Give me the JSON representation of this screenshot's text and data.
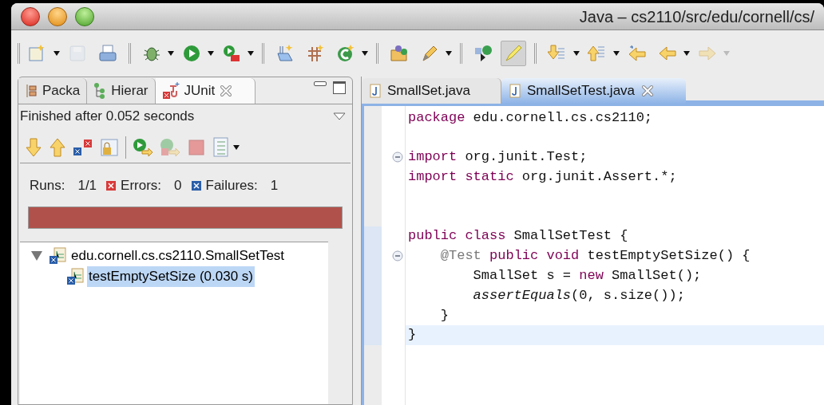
{
  "window": {
    "title": "Java – cs2110/src/edu/cornell/cs/"
  },
  "toolbar": [
    {
      "kind": "new",
      "dropdown": true,
      "disabled": false,
      "selected": false
    },
    {
      "kind": "save",
      "dropdown": false,
      "disabled": true,
      "selected": false
    },
    {
      "kind": "print",
      "dropdown": false,
      "disabled": false,
      "selected": false
    },
    {
      "kind": "sep"
    },
    {
      "kind": "debug",
      "dropdown": true,
      "disabled": false,
      "selected": false
    },
    {
      "kind": "run",
      "dropdown": true,
      "disabled": false,
      "selected": false
    },
    {
      "kind": "external",
      "dropdown": true,
      "disabled": false,
      "selected": false
    },
    {
      "kind": "sep"
    },
    {
      "kind": "package",
      "dropdown": false,
      "disabled": false,
      "selected": false
    },
    {
      "kind": "grid",
      "dropdown": false,
      "disabled": false,
      "selected": false
    },
    {
      "kind": "class",
      "dropdown": true,
      "disabled": false,
      "selected": false
    },
    {
      "kind": "sep"
    },
    {
      "kind": "folder",
      "dropdown": false,
      "disabled": false,
      "selected": false
    },
    {
      "kind": "pen",
      "dropdown": true,
      "disabled": false,
      "selected": false
    },
    {
      "kind": "sep"
    },
    {
      "kind": "hierarchy",
      "dropdown": false,
      "disabled": false,
      "selected": false
    },
    {
      "kind": "highlight",
      "dropdown": false,
      "disabled": false,
      "selected": true
    },
    {
      "kind": "sep"
    },
    {
      "kind": "next",
      "dropdown": true,
      "disabled": false,
      "selected": false
    },
    {
      "kind": "prev",
      "dropdown": true,
      "disabled": false,
      "selected": false
    },
    {
      "kind": "last_edit",
      "dropdown": false,
      "disabled": false,
      "selected": false
    },
    {
      "kind": "back",
      "dropdown": true,
      "disabled": false,
      "selected": false
    },
    {
      "kind": "forward",
      "dropdown": true,
      "disabled": true,
      "selected": false
    }
  ],
  "view_tabs": [
    {
      "kind": "package",
      "label": "Packa",
      "selected": false,
      "closable": false
    },
    {
      "kind": "hierarchy",
      "label": "Hierar",
      "selected": false,
      "closable": false
    },
    {
      "kind": "junit",
      "label": "JUnit",
      "selected": true,
      "closable": true
    }
  ],
  "junit": {
    "status": "Finished after 0.052 seconds",
    "counters": [
      {
        "kind": "runs",
        "label": "Runs:",
        "value": "1/1"
      },
      {
        "kind": "errors",
        "label": "Errors:",
        "value": "0"
      },
      {
        "kind": "failures",
        "label": "Failures:",
        "value": "1"
      }
    ],
    "progress": {
      "level": 1,
      "color": "#b0524b"
    },
    "tree": [
      {
        "label": "edu.cornell.cs.cs2110.SmallSetTest",
        "expanded": true,
        "selected": false,
        "children": [
          {
            "label": "testEmptySetSize (0.030 s)",
            "selected": true
          }
        ]
      }
    ]
  },
  "editor_tabs": [
    {
      "label": "SmallSet.java",
      "selected": false,
      "closable": false
    },
    {
      "label": "SmallSetTest.java",
      "selected": true,
      "closable": true
    }
  ],
  "code": [
    {
      "fold": false,
      "current": false,
      "tokens": [
        {
          "kind": "keyword",
          "text": "package"
        },
        {
          "kind": "plain",
          "text": " edu.cornell.cs.cs2110;"
        }
      ]
    },
    {
      "fold": false,
      "current": false
    },
    {
      "fold": true,
      "current": false,
      "tokens": [
        {
          "kind": "keyword",
          "text": "import"
        },
        {
          "kind": "plain",
          "text": " org.junit.Test;"
        }
      ]
    },
    {
      "fold": false,
      "current": false,
      "tokens": [
        {
          "kind": "keyword",
          "text": "import static"
        },
        {
          "kind": "plain",
          "text": " org.junit.Assert.*;"
        }
      ]
    },
    {
      "fold": false,
      "current": false
    },
    {
      "fold": false,
      "current": false
    },
    {
      "fold": false,
      "current": false,
      "tokens": [
        {
          "kind": "keyword",
          "text": "public class"
        },
        {
          "kind": "plain",
          "text": " SmallSetTest {"
        }
      ]
    },
    {
      "fold": true,
      "current": false,
      "tokens": [
        {
          "kind": "annotation",
          "text": "    @Test"
        },
        {
          "kind": "keyword",
          "text": " public void"
        },
        {
          "kind": "plain",
          "text": " testEmptySetSize() {"
        }
      ]
    },
    {
      "fold": false,
      "current": false,
      "tokens": [
        {
          "kind": "plain",
          "text": "        SmallSet s = "
        },
        {
          "kind": "keyword",
          "text": "new"
        },
        {
          "kind": "plain",
          "text": " SmallSet();"
        }
      ]
    },
    {
      "fold": false,
      "current": false,
      "tokens": [
        {
          "kind": "static",
          "text": "        assertEquals"
        },
        {
          "kind": "plain",
          "text": "(0, s.size());"
        }
      ]
    },
    {
      "fold": false,
      "current": false,
      "tokens": [
        {
          "kind": "plain",
          "text": "    }"
        }
      ]
    },
    {
      "fold": false,
      "current": true,
      "tokens": [
        {
          "kind": "plain",
          "text": "}"
        }
      ]
    }
  ]
}
